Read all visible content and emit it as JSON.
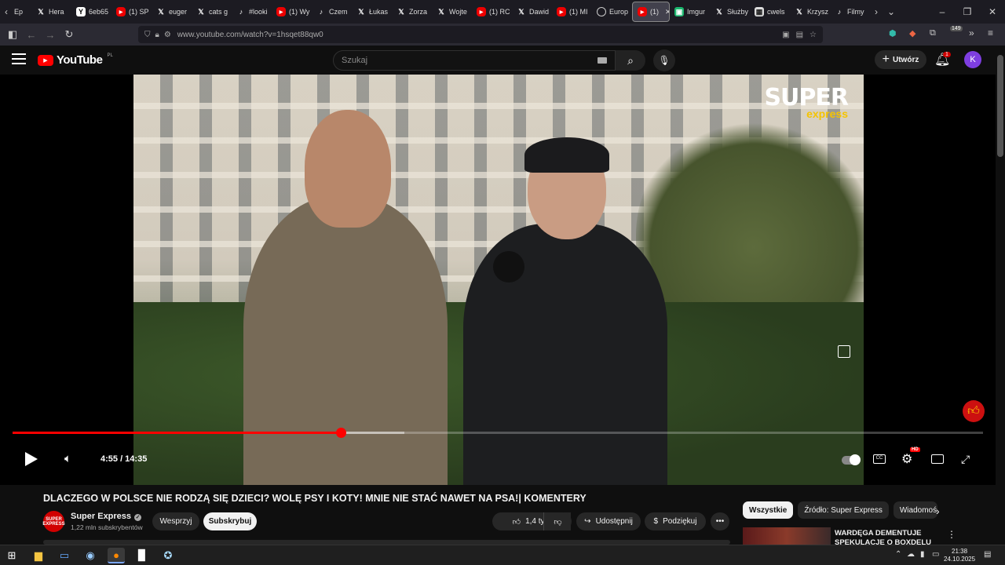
{
  "browser": {
    "tabs": [
      {
        "icon": "x",
        "label": "Hera"
      },
      {
        "icon": "y",
        "label": "6eb65"
      },
      {
        "icon": "yt",
        "label": "(1) SP"
      },
      {
        "icon": "x",
        "label": "euger"
      },
      {
        "icon": "x",
        "label": "cats g"
      },
      {
        "icon": "tt",
        "label": "#looki"
      },
      {
        "icon": "yt",
        "label": "(1) Wy"
      },
      {
        "icon": "tt",
        "label": "Czem"
      },
      {
        "icon": "x",
        "label": "Łukas"
      },
      {
        "icon": "x",
        "label": "Zorza"
      },
      {
        "icon": "x",
        "label": "Wojte"
      },
      {
        "icon": "yt",
        "label": "(1) RC"
      },
      {
        "icon": "x",
        "label": "Dawid"
      },
      {
        "icon": "yt",
        "label": "(1) MI"
      },
      {
        "icon": "globe",
        "label": "Europ"
      },
      {
        "icon": "yt",
        "label": "(1)"
      },
      {
        "icon": "img",
        "label": "Imgur"
      },
      {
        "icon": "x",
        "label": "Służby"
      },
      {
        "icon": "cal",
        "label": "cwels"
      },
      {
        "icon": "x",
        "label": "Krzysz"
      },
      {
        "icon": "tt",
        "label": "Filmy"
      }
    ],
    "first_tab_partial": "Ep",
    "url": "www.youtube.com/watch?v=1hsqet88qw0",
    "ext_badge": "149"
  },
  "youtube": {
    "logo": "YouTube",
    "region": "PL",
    "search_placeholder": "Szukaj",
    "create_label": "Utwórz",
    "notification_count": "1",
    "avatar_letter": "K"
  },
  "player": {
    "watermark_top": "SUPER",
    "watermark_bottom": "express",
    "time": "4:55 / 14:35",
    "progress_fraction": 0.338,
    "buffered_fraction": 0.404,
    "hd_badge": "HD"
  },
  "video": {
    "title": "DLACZEGO W POLSCE NIE RODZĄ SIĘ DZIECI? WOLĘ PSY I KOTY! MNIE NIE STAĆ NAWET NA PSA!| KOMENTERY",
    "channel_name": "Super Express",
    "channel_avatar": "SUPER EXPRESS",
    "subscribers": "1,22 mln subskrybentów",
    "support_label": "Wesprzyj",
    "subscribe_label": "Subskrybuj",
    "likes": "1,4 tys.",
    "share_label": "Udostępnij",
    "thanks_label": "Podziękuj"
  },
  "sidebar": {
    "chips": [
      "Wszystkie",
      "Źródło: Super Express",
      "Wiadomoś"
    ],
    "rec_title": "WARDĘGA DEMENTUJE SPEKULACJE O BOXDELU"
  },
  "taskbar": {
    "time": "21:38",
    "date": "24.10.2025"
  }
}
